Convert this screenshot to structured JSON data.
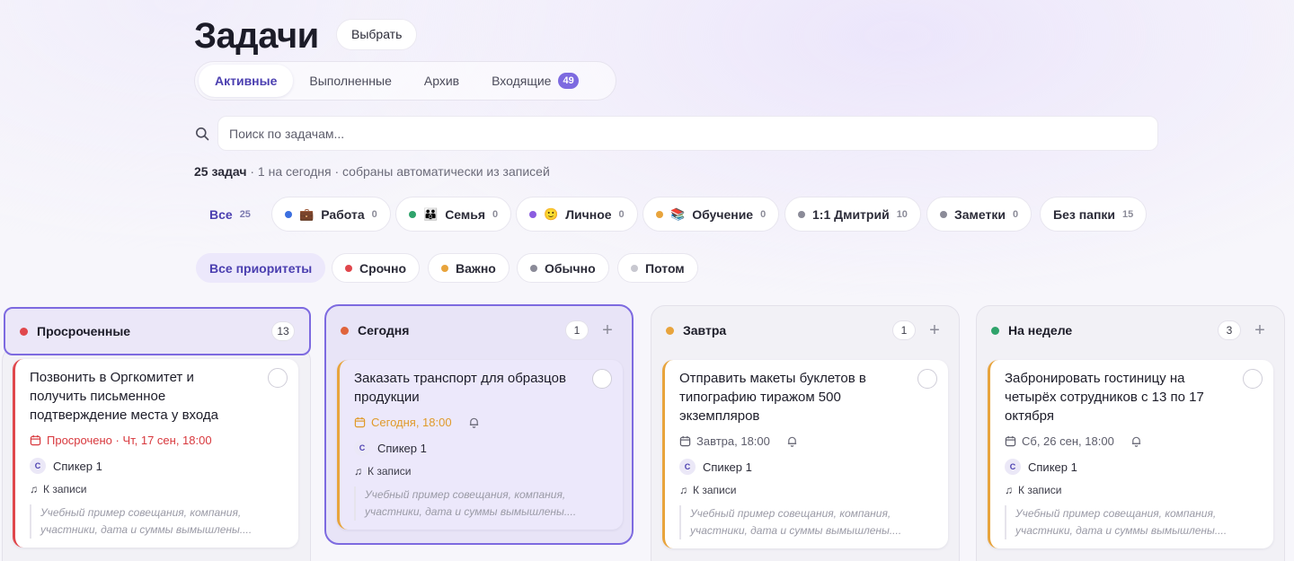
{
  "header": {
    "title": "Задачи",
    "select_label": "Выбрать"
  },
  "tabs": [
    {
      "label": "Активные",
      "active": true
    },
    {
      "label": "Выполненные"
    },
    {
      "label": "Архив"
    },
    {
      "label": "Входящие",
      "badge": "49"
    }
  ],
  "search": {
    "placeholder": "Поиск по задачам..."
  },
  "summary": {
    "count": "25 задач",
    "rest": " · 1 на сегодня · собраны автоматически из записей"
  },
  "folders": [
    {
      "label": "Все",
      "count": "25"
    },
    {
      "label": "Работа",
      "count": "0",
      "emoji": "💼",
      "color": "#3b6fe0"
    },
    {
      "label": "Семья",
      "count": "0",
      "emoji": "👪",
      "color": "#2fa36b"
    },
    {
      "label": "Личное",
      "count": "0",
      "emoji": "🙂",
      "color": "#8a5ce0"
    },
    {
      "label": "Обучение",
      "count": "0",
      "emoji": "📚",
      "color": "#e8a43c"
    },
    {
      "label": "1:1 Дмитрий",
      "count": "10",
      "color": "#8b8b98"
    },
    {
      "label": "Заметки",
      "count": "0",
      "color": "#8b8b98"
    },
    {
      "label": "Без папки",
      "count": "15"
    }
  ],
  "priorities": [
    {
      "label": "Все приоритеты"
    },
    {
      "label": "Срочно",
      "color": "#e0474c"
    },
    {
      "label": "Важно",
      "color": "#e8a43c"
    },
    {
      "label": "Обычно",
      "color": "#8b8b98"
    },
    {
      "label": "Потом",
      "color": "#c8c8d0"
    }
  ],
  "columns": [
    {
      "title": "Просроченные",
      "count": "13",
      "color": "#e0474c",
      "card": {
        "title": "Позвонить в Оргкомитет и получить письменное подтверждение места у входа",
        "due": "Просрочено · Чт, 17 сен, 18:00",
        "speaker_initial": "С",
        "speaker": "Спикер 1",
        "record": "К записи",
        "quote": "Учебный пример совещания, компания, участники, дата и суммы вымышлены...."
      }
    },
    {
      "title": "Сегодня",
      "count": "1",
      "color": "#e0643c",
      "card": {
        "title": "Заказать транспорт для образцов продукции",
        "due": "Сегодня, 18:00",
        "speaker_initial": "С",
        "speaker": "Спикер 1",
        "record": "К записи",
        "quote": "Учебный пример совещания, компания, участники, дата и суммы вымышлены...."
      }
    },
    {
      "title": "Завтра",
      "count": "1",
      "color": "#e8a43c",
      "card": {
        "title": "Отправить макеты буклетов в типографию тиражом 500 экземпляров",
        "due": "Завтра, 18:00",
        "speaker_initial": "С",
        "speaker": "Спикер 1",
        "record": "К записи",
        "quote": "Учебный пример совещания, компания, участники, дата и суммы вымышлены...."
      }
    },
    {
      "title": "На неделе",
      "count": "3",
      "color": "#2fa36b",
      "card": {
        "title": "Забронировать гостиницу на четырёх сотрудников с 13 по 17 октября",
        "due": "Сб, 26 сен, 18:00",
        "speaker_initial": "С",
        "speaker": "Спикер 1",
        "record": "К записи",
        "quote": "Учебный пример совещания, компания, участники, дата и суммы вымышлены...."
      }
    }
  ]
}
